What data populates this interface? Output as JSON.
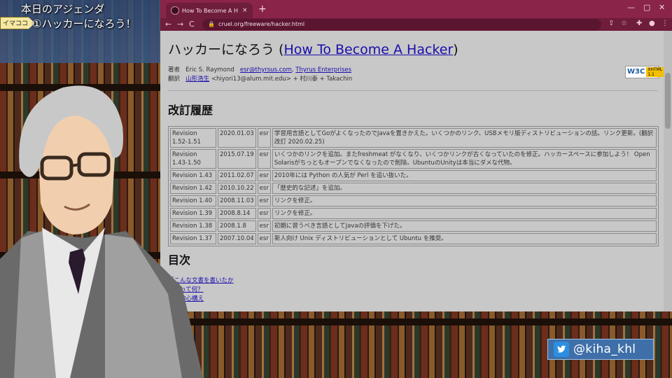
{
  "overlay": {
    "agenda_title": "本日のアジェンダ",
    "agenda_item": "①ハッカーになろう！",
    "marker_label": "イマココ",
    "twitter_handle": "@kiha_khl"
  },
  "browser": {
    "tab_title": "How To Become A Hacker: Japa",
    "tab_close": "×",
    "new_tab": "+",
    "url": "cruel.org/freeware/hacker.html",
    "window_controls": [
      "—",
      "▢",
      "✕"
    ],
    "nav": [
      "←",
      "→",
      "C"
    ]
  },
  "page": {
    "title_prefix": "ハッカーになろう (",
    "title_link": "How To Become A Hacker",
    "title_suffix": ")",
    "author_label": "著者",
    "author_name": "Eric S. Raymond",
    "author_email": "esr@thyrsus.com",
    "author_org": "Thyrus Enterprises",
    "translator_label": "翻訳",
    "translator_name": "山形浩生",
    "translator_rest": "<hiyori13@alum.mit.edu> + 村川泰 + Takachin",
    "w3c_logo": "W3C",
    "w3c_badge": "XHTML 1.1",
    "revision_heading": "改訂履歴",
    "revisions": [
      {
        "rev": "Revision 1.52-1.51",
        "date": "2020.01.03",
        "by": "esr",
        "note": "学習用言語としてGoがよくなったのでJavaを置きかえた。いくつかのリンク、USBメモリ版ディストリビューションの話。リンク更新。(翻訳改訂 2020.02.25)"
      },
      {
        "rev": "Revision 1.43-1.50",
        "date": "2015.07.19",
        "by": "esr",
        "note": "いくつかのリンクを追加。またfreshmeat がなくなり、いくつかリンクが古くなっていたのを修正。ハッカースペースに参加しよう！ Open Solarisがちっともオープンでなくなったので削除。UbuntuのUnityは本当にダメな代物。"
      },
      {
        "rev": "Revision 1.43",
        "date": "2011.02.07",
        "by": "esr",
        "note": "2010年には Python の人気が Perl を追い抜いた。"
      },
      {
        "rev": "Revision 1.42",
        "date": "2010.10.22",
        "by": "esr",
        "note": "「歴史的な記述」を追加。"
      },
      {
        "rev": "Revision 1.40",
        "date": "2008.11.03",
        "by": "esr",
        "note": "リンクを修正。"
      },
      {
        "rev": "Revision 1.39",
        "date": "2008.8.14",
        "by": "esr",
        "note": "リンクを修正。"
      },
      {
        "rev": "Revision 1.38",
        "date": "2008.1.8",
        "by": "esr",
        "note": "初期に習うべき言語としてJavaの評価を下げた。"
      },
      {
        "rev": "Revision 1.37",
        "date": "2007.10.04",
        "by": "esr",
        "note": "新人向け Unix ディストリビューションとして Ubuntu を推奨。"
      }
    ],
    "toc_heading": "目次",
    "toc_links": [
      "「こんな文書を書いたか",
      "カーって何？",
      "カー的心構え"
    ]
  }
}
